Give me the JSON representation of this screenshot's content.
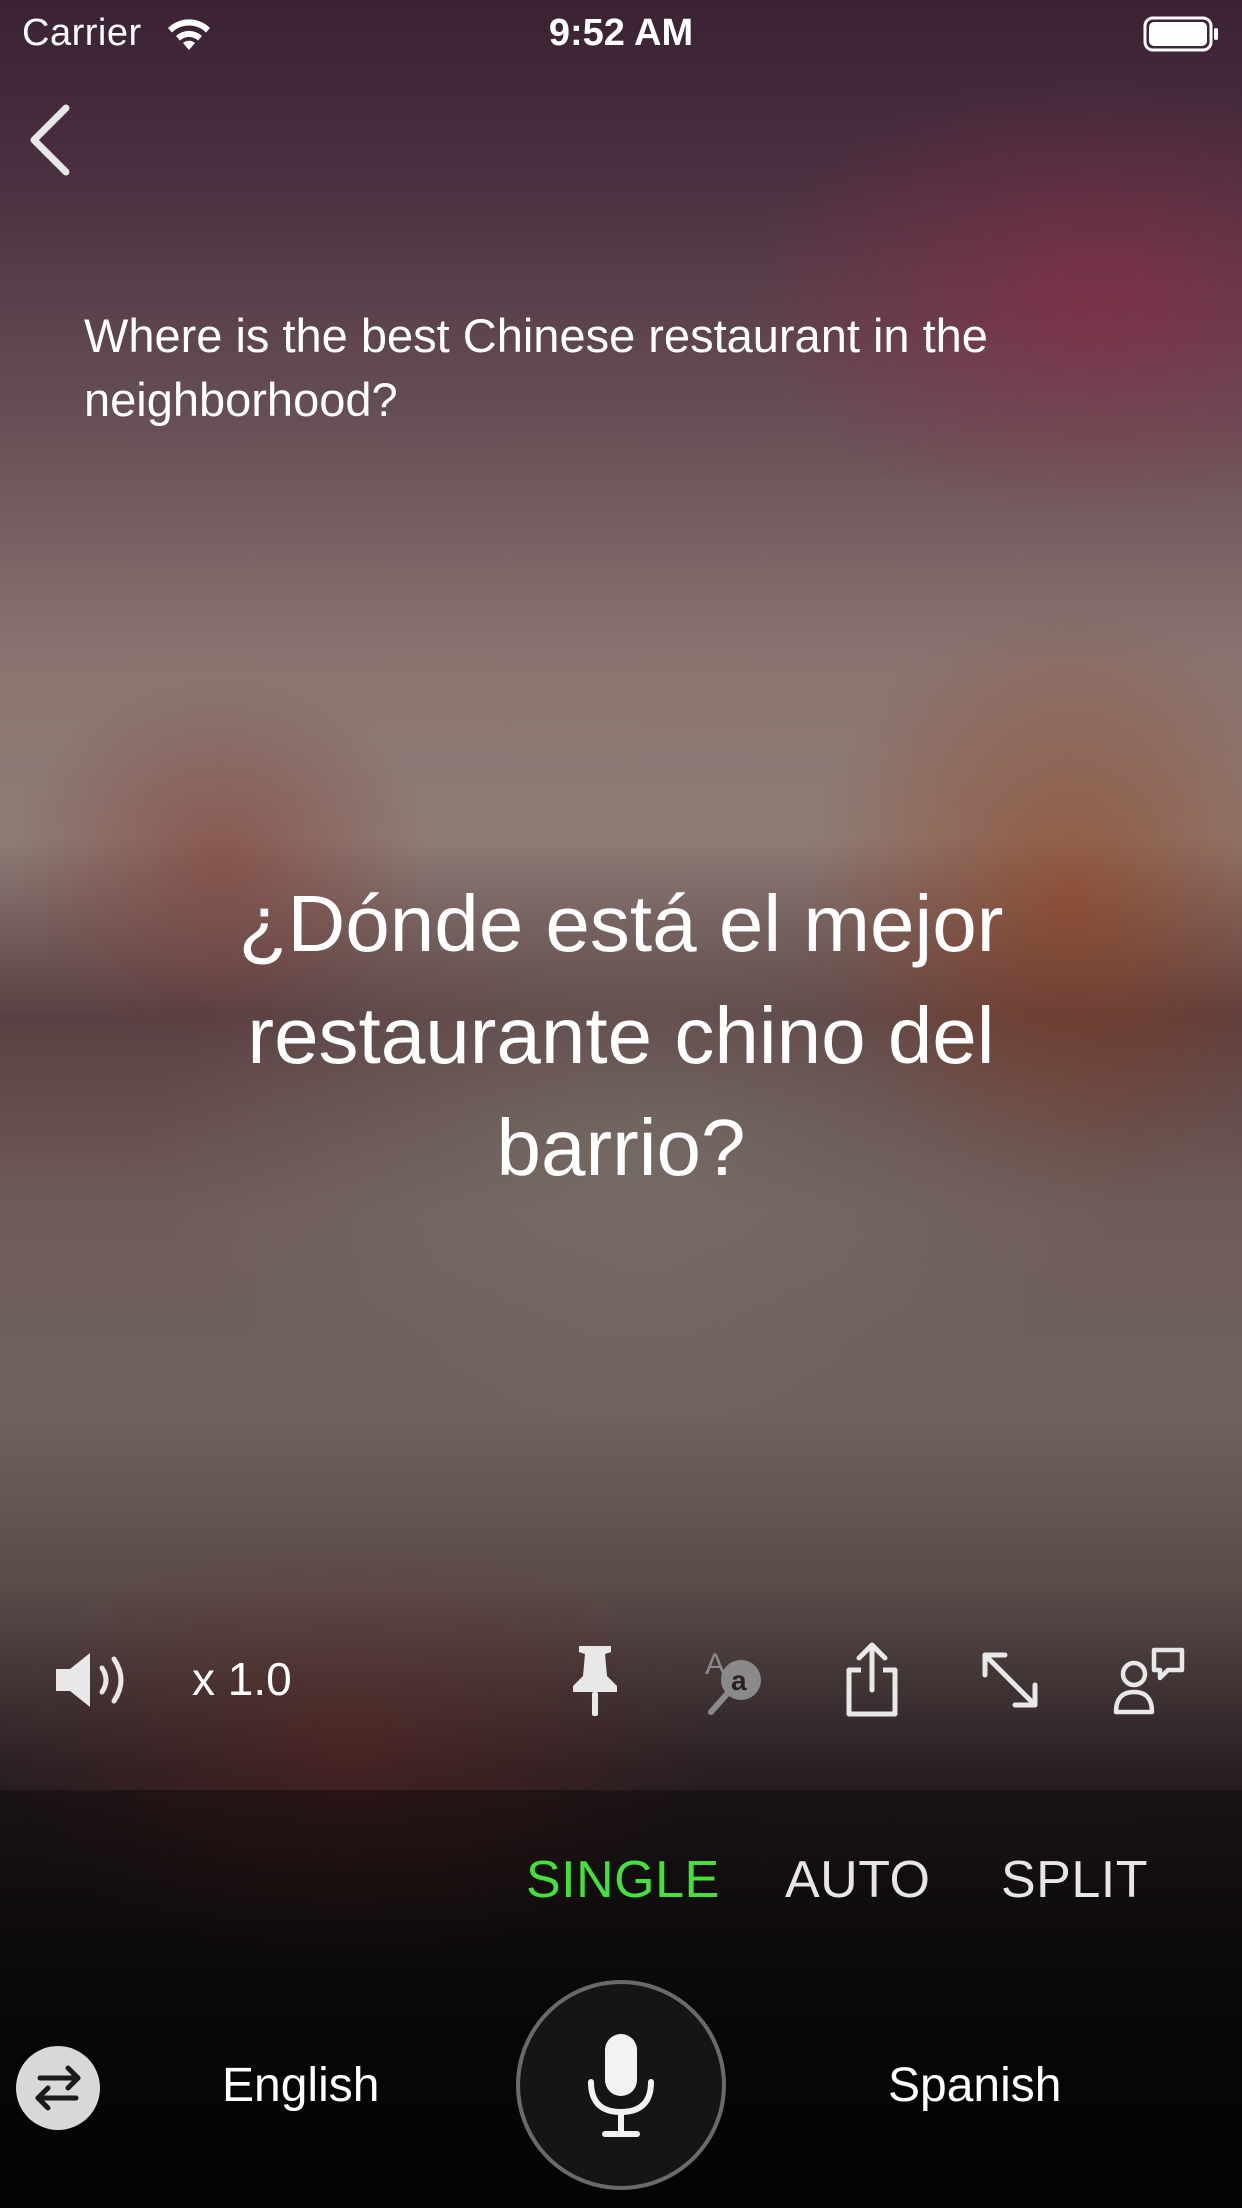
{
  "status_bar": {
    "carrier": "Carrier",
    "time": "9:52 AM",
    "icons": [
      "wifi-icon",
      "battery-icon"
    ]
  },
  "navigation": {
    "back_icon": "chevron-left-icon"
  },
  "source_text": "Where is the best Chinese restaurant in the neighborhood?",
  "translated_text": "¿Dónde está el mejor restaurante chino del barrio?",
  "controls": {
    "speaker_icon": "speaker-icon",
    "speed": "x 1.0",
    "icons": [
      "pin-icon",
      "translate-icon",
      "share-icon",
      "expand-icon",
      "conversation-icon"
    ]
  },
  "modes": {
    "items": [
      "SINGLE",
      "AUTO",
      "SPLIT"
    ],
    "selected": "SINGLE",
    "active_color": "#45e03c"
  },
  "languages": {
    "source": "English",
    "target": "Spanish",
    "swap_icon": "swap-arrows-icon",
    "mic_icon": "microphone-icon"
  }
}
